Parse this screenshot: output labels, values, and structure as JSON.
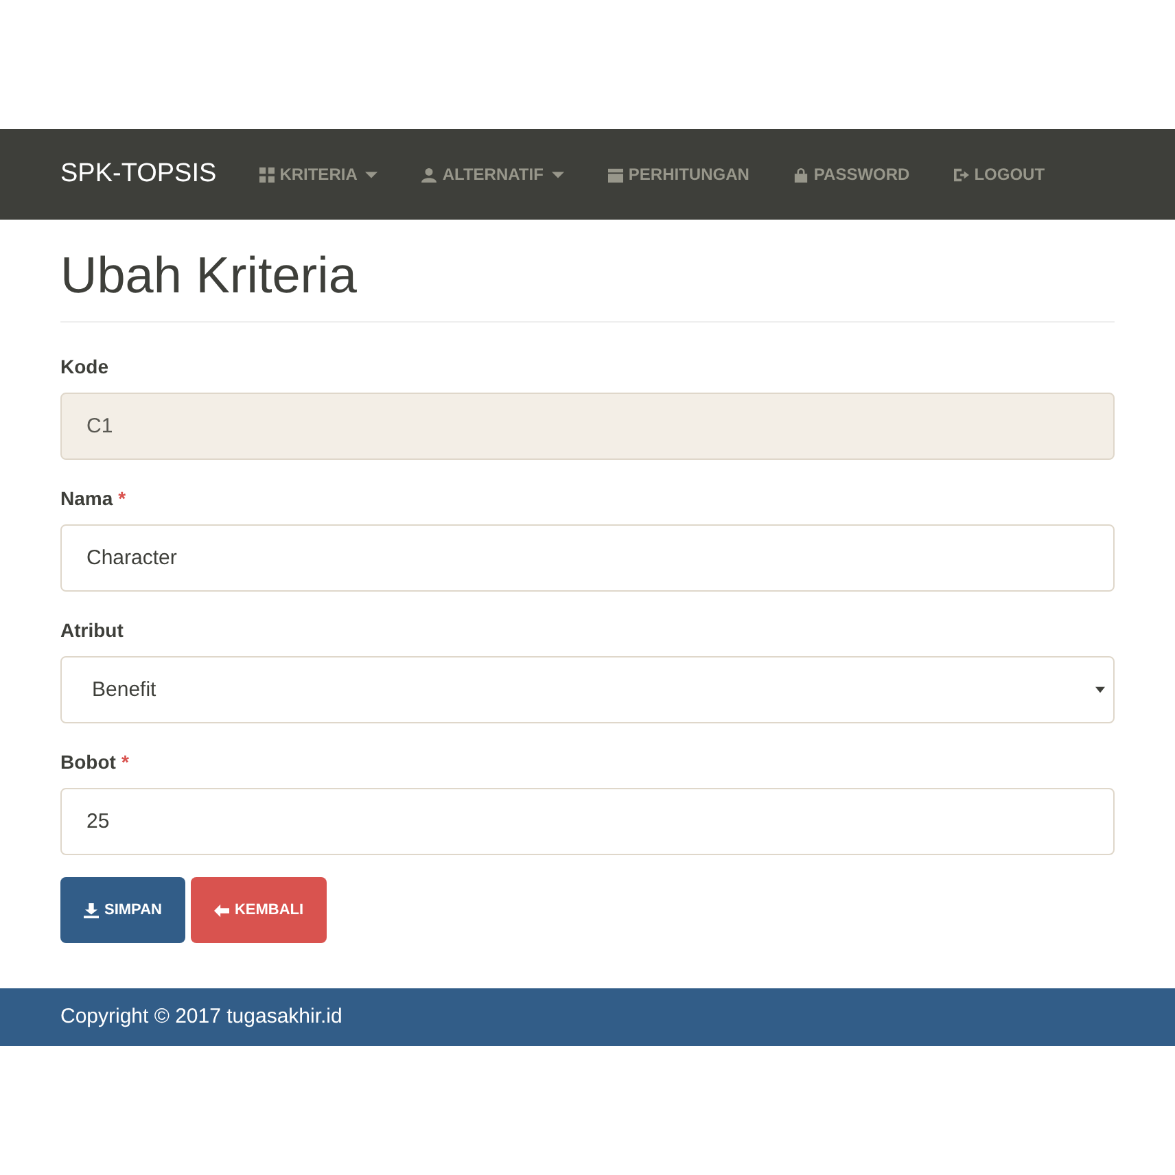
{
  "navbar": {
    "brand": "SPK-TOPSIS",
    "items": [
      {
        "label": "KRITERIA",
        "kind": "grid",
        "dropdown": true
      },
      {
        "label": "ALTERNATIF",
        "kind": "user",
        "dropdown": true
      },
      {
        "label": "PERHITUNGAN",
        "kind": "calendar",
        "dropdown": false
      },
      {
        "label": "PASSWORD",
        "kind": "lock",
        "dropdown": false
      },
      {
        "label": "LOGOUT",
        "kind": "logout",
        "dropdown": false
      }
    ]
  },
  "page_title": "Ubah Kriteria",
  "form": {
    "fields": [
      {
        "label": "Kode",
        "kind": "text",
        "value": "C1",
        "disabled": true
      },
      {
        "label": "Nama",
        "required_mark": "*",
        "kind": "text",
        "value": "Character",
        "disabled": false
      },
      {
        "label": "Atribut",
        "kind": "select",
        "value": "Benefit",
        "disabled": false
      },
      {
        "label": "Bobot",
        "required_mark": "*",
        "kind": "text",
        "value": "25",
        "disabled": false
      }
    ],
    "buttons": [
      {
        "label": "SIMPAN",
        "kind": "save"
      },
      {
        "label": "KEMBALI",
        "kind": "back"
      }
    ]
  },
  "footer": "Copyright © 2017 tugasakhir.id"
}
